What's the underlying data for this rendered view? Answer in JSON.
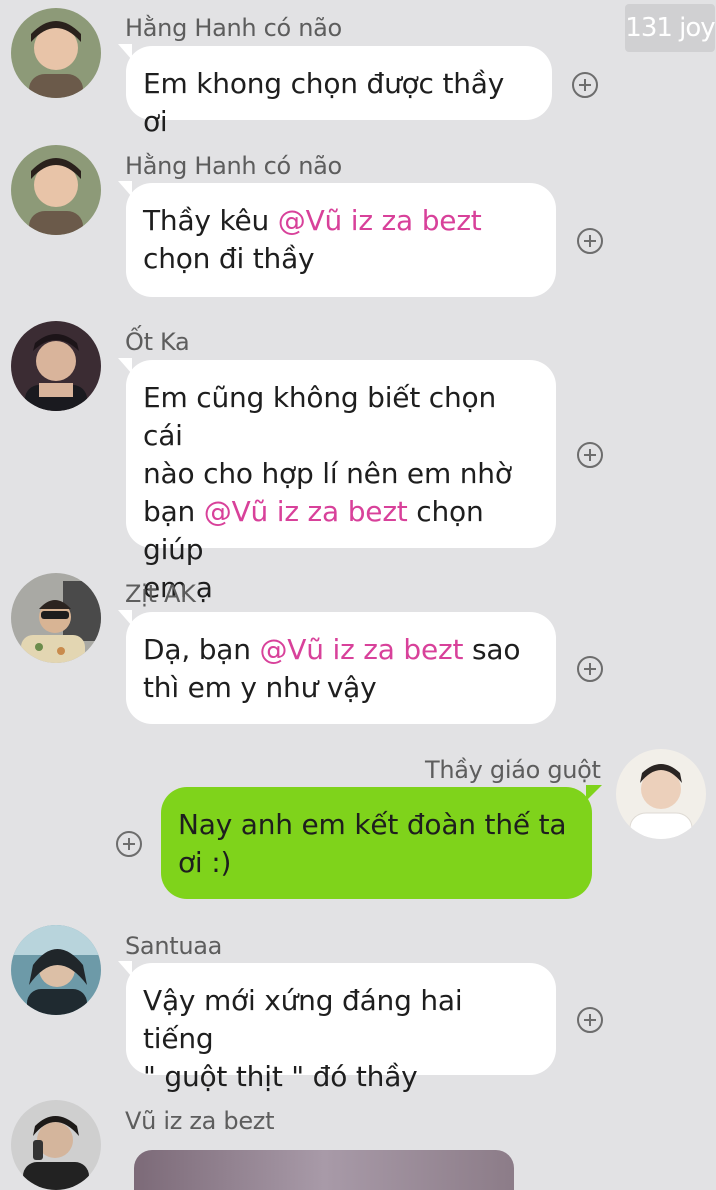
{
  "header": {
    "count_badge": "131 joy"
  },
  "messages": [
    {
      "sender": "Hằng Hanh có não",
      "text_parts": [
        "Em khong chọn được thầy ơi"
      ]
    },
    {
      "sender": "Hằng Hanh có não",
      "line1_pre": "Thầy kêu ",
      "line1_mention": "@Vũ iz za bezt",
      "line2": "chọn đi thầy"
    },
    {
      "sender": "Ốt Ka",
      "line1": "Em cũng không biết chọn cái",
      "line2": "nào cho hợp lí nên em nhờ",
      "line3_pre": "bạn ",
      "line3_mention": "@Vũ iz za bezt",
      "line3_post": " chọn giúp",
      "line4": "em ạ"
    },
    {
      "sender": "Zịt AK",
      "line1_pre": "Dạ, bạn ",
      "line1_mention": "@Vũ iz za bezt",
      "line1_post": " sao",
      "line2": "thì em y như vậy"
    },
    {
      "sender": "Thầy giáo guột",
      "line1": "Nay anh em kết đoàn thế ta",
      "line2": "ơi :)"
    },
    {
      "sender": "Santuaa",
      "line1": "Vậy mới xứng đáng hai tiếng",
      "line2": "\" guột thịt \" đó thầy"
    },
    {
      "sender": "Vũ iz za bezt"
    }
  ],
  "colors": {
    "background": "#e2e2e4",
    "incoming_bubble": "#ffffff",
    "outgoing_bubble": "#7fd31b",
    "mention": "#d8419a"
  }
}
